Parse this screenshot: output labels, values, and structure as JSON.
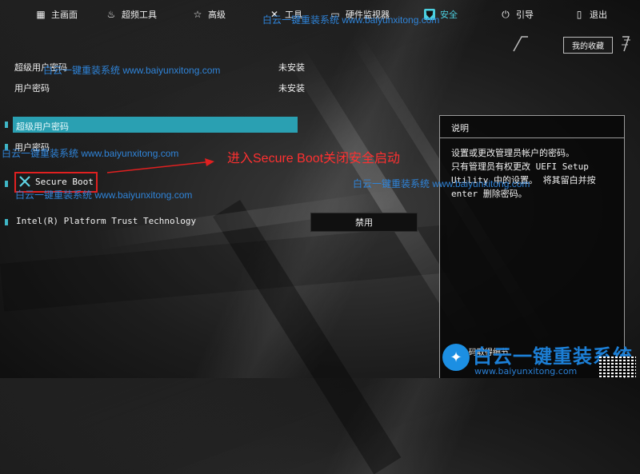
{
  "nav": {
    "items": [
      {
        "label": "主画面",
        "icon": "grid-icon"
      },
      {
        "label": "超频工具",
        "icon": "flame-icon"
      },
      {
        "label": "高级",
        "icon": "star-icon"
      },
      {
        "label": "工具",
        "icon": "tools-icon"
      },
      {
        "label": "硬件监视器",
        "icon": "monitor-icon"
      },
      {
        "label": "安全",
        "icon": "shield-icon",
        "active": true
      },
      {
        "label": "引导",
        "icon": "power-icon"
      },
      {
        "label": "退出",
        "icon": "exit-icon"
      }
    ],
    "active_color": "#4cd0e0"
  },
  "favorites": {
    "label": "我的收藏"
  },
  "settings": {
    "supervisor_password": {
      "label": "超级用户密码",
      "value": "未安装"
    },
    "user_password": {
      "label": "用户密码",
      "value": "未安装"
    },
    "menu": {
      "supervisor_item": "超级用户密码",
      "user_item": "用户密码",
      "secure_boot": "Secure Boot",
      "ptt": "Intel(R) Platform Trust Technology",
      "ptt_value": "禁用"
    },
    "selected_color": "#2aa0b2"
  },
  "annotation": {
    "text": "进入Secure Boot关闭安全启动",
    "color": "#ff3030"
  },
  "description": {
    "title": "说明",
    "body": "设置或更改管理员帐户的密码。\n只有管理员有权更改 UEFI Setup\nUtility 中的设置。 将其留白并按\nenter 删除密码。"
  },
  "footer": {
    "qr_text": "QR码取得细节"
  },
  "watermark": {
    "text": "白云一键重装系统 www.baiyunxitong.com",
    "brand_name": "白云一键重装系统",
    "brand_url": "www.baiyunxitong.com",
    "color": "#2f84d9"
  }
}
